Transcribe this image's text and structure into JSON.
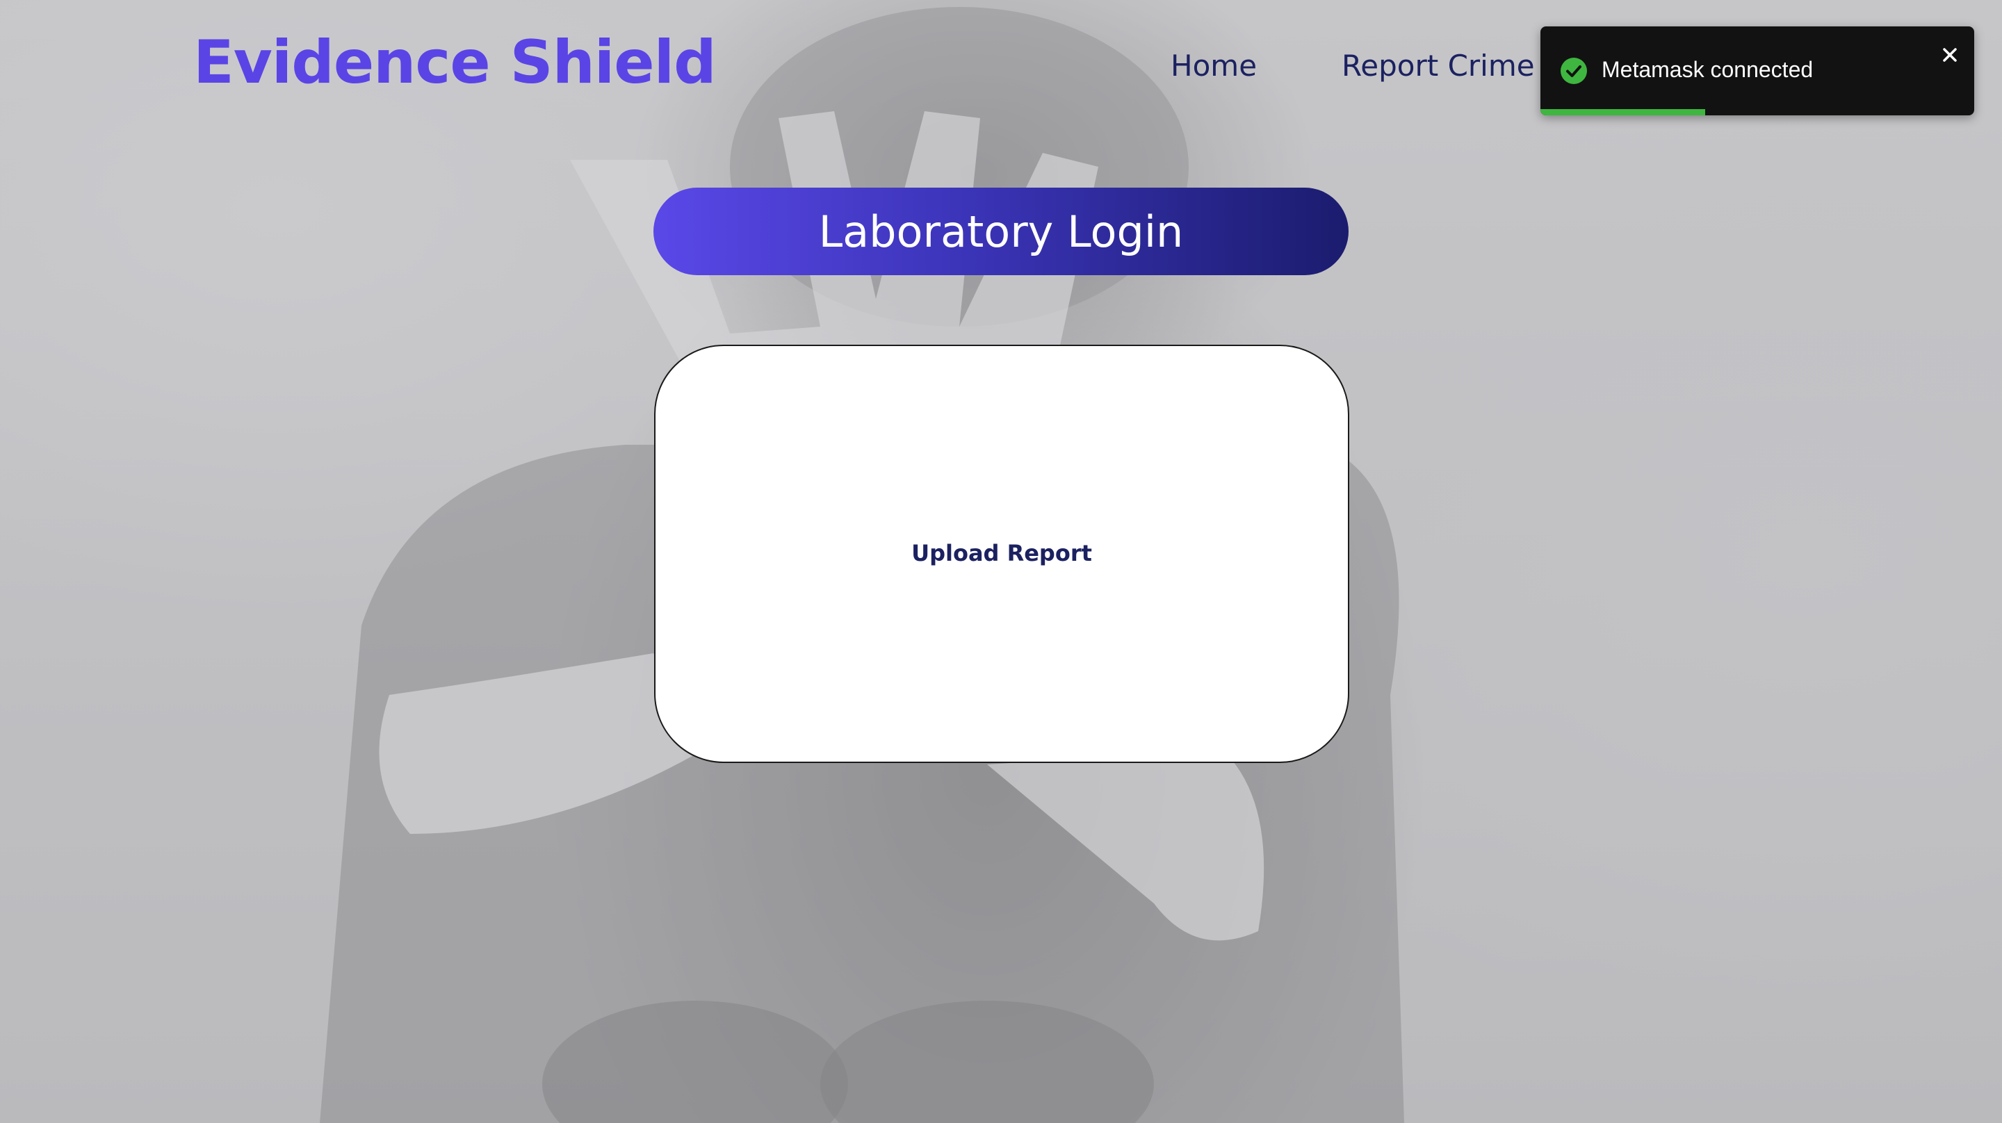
{
  "header": {
    "brand": "Evidence Shield",
    "nav": [
      "Home",
      "Report Crime"
    ]
  },
  "toast": {
    "message": "Metamask connected",
    "icon": "check-circle-icon",
    "close_icon": "close-icon",
    "status_color": "#3fb640",
    "progress": 0.38
  },
  "main": {
    "title": "Laboratory Login",
    "upload_label": "Upload Report"
  },
  "colors": {
    "brand": "#5a44e6",
    "nav_text": "#1b2160",
    "pill_start": "#5a48e8",
    "pill_end": "#1b1c6e"
  },
  "background": {
    "description_icon": "background-photo"
  }
}
